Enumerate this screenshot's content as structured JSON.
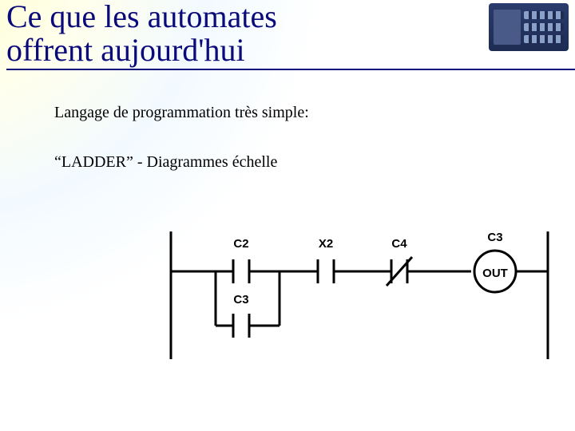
{
  "title": "Ce que les automates offrent aujourd'hui",
  "bullets": {
    "b1": "Langage de programmation très simple:",
    "b2": "“LADDER” - Diagrammes échelle"
  },
  "ladder": {
    "c2": "C2",
    "c3_top": "C3",
    "x2": "X2",
    "c4": "C4",
    "c3_out": "C3",
    "out": "OUT"
  }
}
